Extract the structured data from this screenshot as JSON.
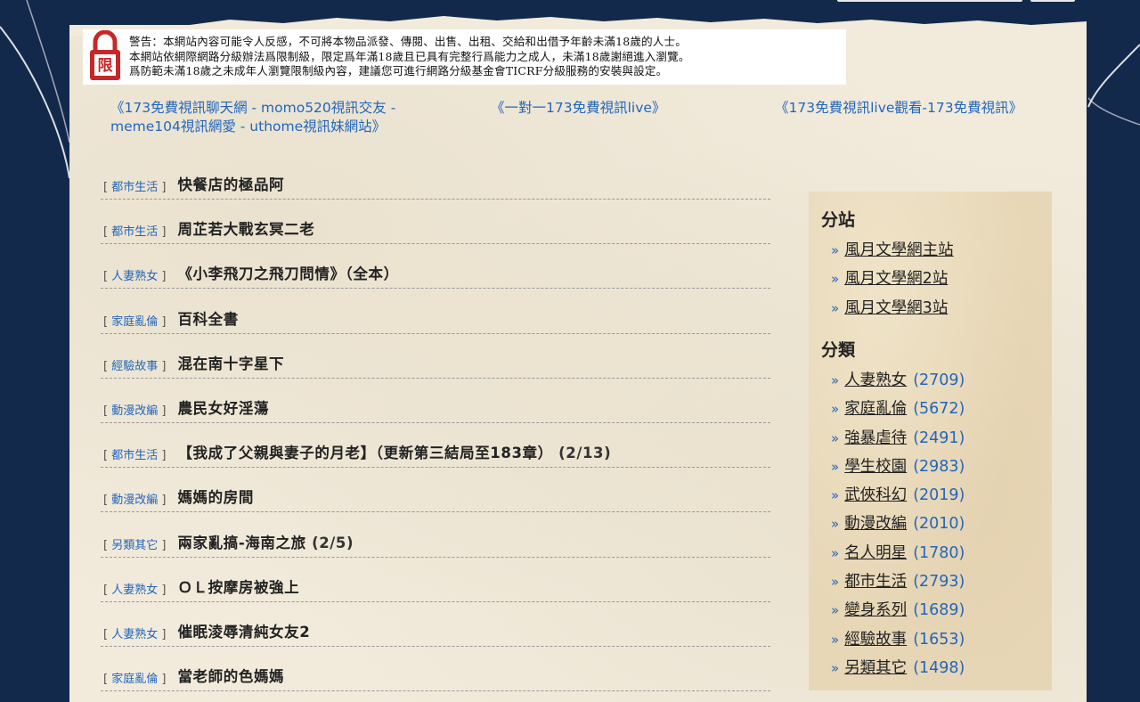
{
  "warning": {
    "icon": "lock-restricted-icon",
    "icon_text": "限",
    "lines": [
      "警告：本網站內容可能令人反感，不可將本物品派發、傳閱、出售、出租、交給和出借予年齡未滿18歲的人士。",
      "本網站依網際網路分級辦法爲限制級，限定爲年滿18歲且已具有完整行爲能力之成人，未滿18歲謝絕進入瀏覽。",
      "爲防範未滿18歲之未成年人瀏覽限制級內容，建議您可進行網路分級基金會TICRF分級服務的安裝與設定。"
    ]
  },
  "top_links": [
    "《173免費視訊聊天網 - momo520視訊交友 - meme104視訊網愛 - uthome視訊妹網站》",
    "《一對一173免費視訊live》",
    "《173免費視訊live觀看-173免費視訊》"
  ],
  "posts": [
    {
      "category": "都市生活",
      "title": "快餐店的極品阿",
      "pages": ""
    },
    {
      "category": "都市生活",
      "title": "周芷若大戰玄冥二老",
      "pages": ""
    },
    {
      "category": "人妻熟女",
      "title": "《小李飛刀之飛刀問情》（全本）",
      "pages": ""
    },
    {
      "category": "家庭亂倫",
      "title": "百科全書",
      "pages": ""
    },
    {
      "category": "經驗故事",
      "title": "混在南十字星下",
      "pages": ""
    },
    {
      "category": "動漫改編",
      "title": "農民女好淫蕩",
      "pages": ""
    },
    {
      "category": "都市生活",
      "title": "【我成了父親與妻子的月老】（更新第三結局至183章）",
      "pages": "(2/13)"
    },
    {
      "category": "動漫改編",
      "title": "媽媽的房間",
      "pages": ""
    },
    {
      "category": "另類其它",
      "title": "兩家亂搞-海南之旅",
      "pages": "(2/5)"
    },
    {
      "category": "人妻熟女",
      "title": "ＯＬ按摩房被強上",
      "pages": ""
    },
    {
      "category": "人妻熟女",
      "title": "催眠淩辱清純女友2",
      "pages": ""
    },
    {
      "category": "家庭亂倫",
      "title": "當老師的色媽媽",
      "pages": ""
    }
  ],
  "sidebar": {
    "sites_heading": "分站",
    "sites": [
      "風月文學網主站",
      "風月文學網2站",
      "風月文學網3站"
    ],
    "categories_heading": "分類",
    "categories": [
      {
        "name": "人妻熟女",
        "count": "(2709)"
      },
      {
        "name": "家庭亂倫",
        "count": "(5672)"
      },
      {
        "name": "強暴虐待",
        "count": "(2491)"
      },
      {
        "name": "學生校園",
        "count": "(2983)"
      },
      {
        "name": "武俠科幻",
        "count": "(2019)"
      },
      {
        "name": "動漫改編",
        "count": "(2010)"
      },
      {
        "name": "名人明星",
        "count": "(1780)"
      },
      {
        "name": "都市生活",
        "count": "(2793)"
      },
      {
        "name": "變身系列",
        "count": "(1689)"
      },
      {
        "name": "經驗故事",
        "count": "(1653)"
      },
      {
        "name": "另類其它",
        "count": "(1498)"
      }
    ],
    "bullet": "»"
  },
  "colors": {
    "background": "#13294b",
    "paper": "#f2ebdc",
    "link": "#2266bb",
    "sidebar": "#e7d7b7",
    "lock_red": "#c62828"
  }
}
